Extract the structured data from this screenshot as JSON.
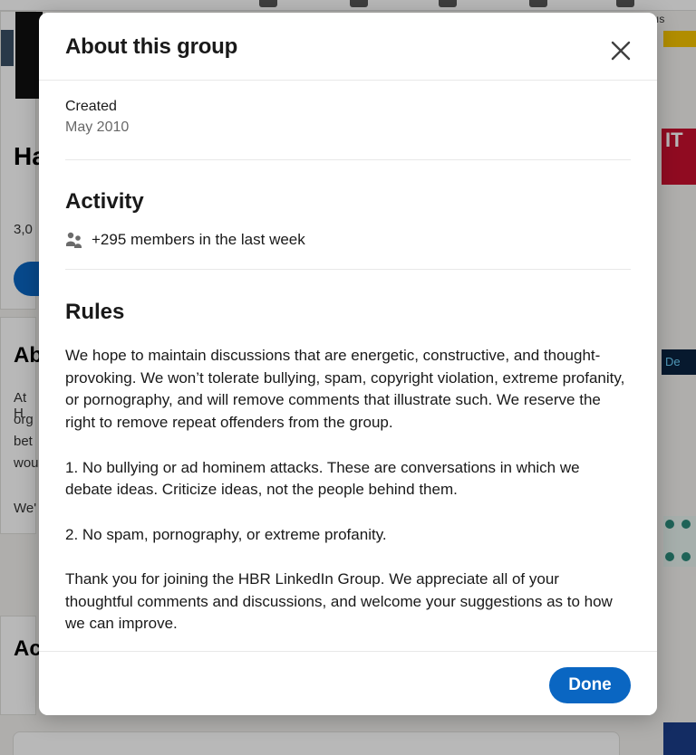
{
  "background": {
    "nav_partial_text": "ıs",
    "group_name_partial": "Ha",
    "members_partial": "3,0",
    "about_partial": "Ab",
    "about_lines_partial": [
      "At H",
      "org",
      "bet",
      "wou"
    ],
    "about_more_partial": "We'",
    "activity_partial": "Ac",
    "ad_it_text": "IT",
    "ad_dark_text": "De"
  },
  "modal": {
    "title": "About this group",
    "close_label": "Close",
    "created": {
      "label": "Created",
      "value": "May 2010"
    },
    "activity": {
      "heading": "Activity",
      "members_text": "+295 members in the last week"
    },
    "rules": {
      "heading": "Rules",
      "paragraphs": [
        "We hope to maintain discussions that are energetic, constructive, and thought-provoking. We won’t tolerate bullying, spam, copyright violation, extreme profanity, or pornography, and will remove comments that illustrate such. We reserve the right to remove repeat offenders from the group.",
        "1. No bullying or ad hominem attacks. These are conversations in which we debate ideas. Criticize ideas, not the people behind them.",
        "2. No spam, pornography, or extreme profanity.",
        "Thank you for joining the HBR LinkedIn Group. We appreciate all of your thoughtful comments and discussions, and welcome your suggestions as to how we can improve."
      ]
    },
    "done_label": "Done"
  },
  "colors": {
    "primary": "#0a66c2",
    "text": "#1f1f1f",
    "muted": "#666666",
    "divider": "#e8e8e8"
  },
  "icons": {
    "close": "close-icon",
    "members": "members-icon"
  }
}
